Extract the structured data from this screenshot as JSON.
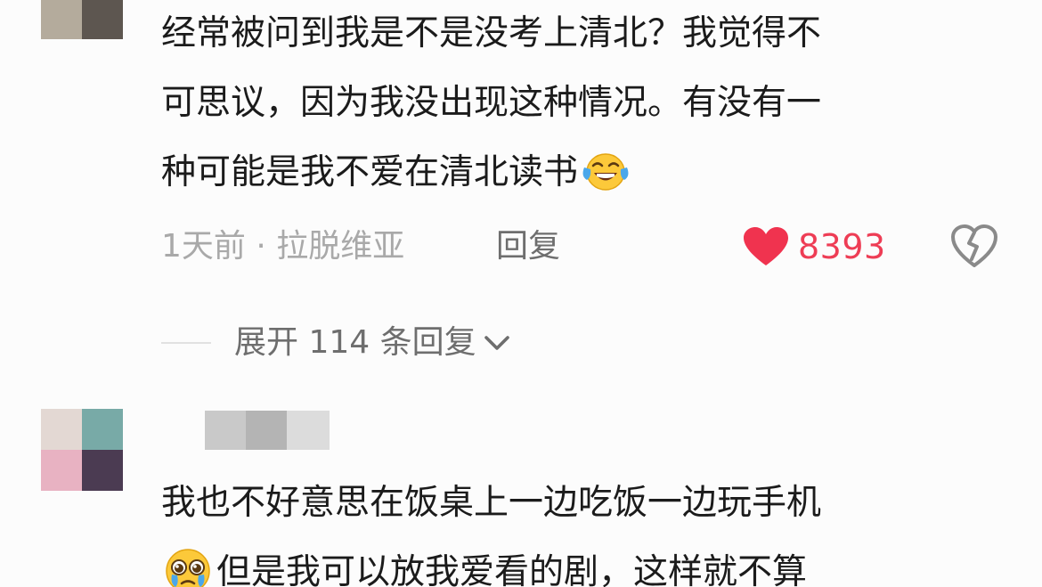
{
  "comments": [
    {
      "lines": [
        "经常被问到我是不是没考上清北？我觉得不",
        "可思议，因为我没出现这种情况。有没有一",
        "种可能是我不爱在清北读书"
      ],
      "emoji": "face-with-tears-of-joy",
      "meta": "1天前 · 拉脱维亚",
      "reply_label": "回复",
      "like_count": "8393",
      "like_color": "#ee3d55",
      "expand_label": "展开 114 条回复"
    },
    {
      "lines": [
        "我也不好意思在饭桌上一边吃饭一边玩手机",
        "但是我可以放我爱看的剧，这样就不算"
      ],
      "emoji": "pleading-face"
    }
  ],
  "icons": {
    "like": "heart-icon",
    "dislike": "broken-heart-icon",
    "expand": "chevron-down-icon"
  }
}
